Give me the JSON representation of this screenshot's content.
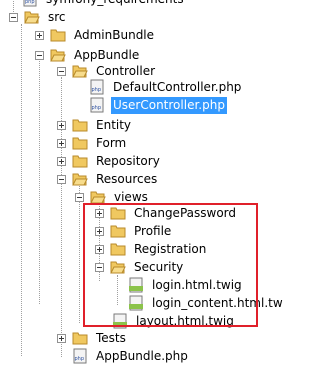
{
  "tree": {
    "top_partial": "symfony_requirements",
    "src": "src",
    "admin_bundle": "AdminBundle",
    "app_bundle": "AppBundle",
    "controller": "Controller",
    "default_controller": "DefaultController.php",
    "user_controller": "UserController.php",
    "entity": "Entity",
    "form": "Form",
    "repository": "Repository",
    "resources": "Resources",
    "views": "views",
    "change_password": "ChangePassword",
    "profile": "Profile",
    "registration": "Registration",
    "security": "Security",
    "login_twig": "login.html.twig",
    "login_content_twig": "login_content.html.tw",
    "layout_twig": "layout.html.twig",
    "tests": "Tests",
    "app_bundle_php": "AppBundle.php"
  },
  "colors": {
    "selection": "#3399ff",
    "highlight_border": "#e0202a",
    "folder_fill": "#f0c860"
  }
}
